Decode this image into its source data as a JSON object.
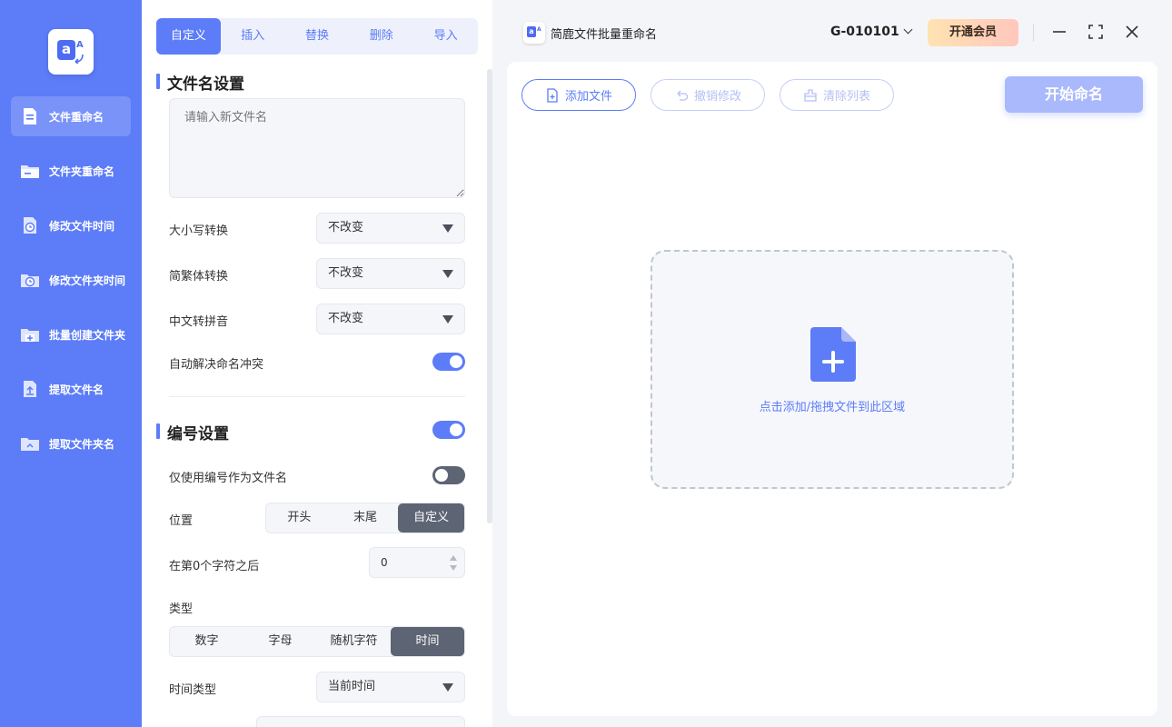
{
  "sidebar": {
    "logo_letter": "a",
    "logo_mini": "A",
    "items": [
      {
        "label": "文件重命名",
        "icon": "document-icon",
        "active": true
      },
      {
        "label": "文件夹重命名",
        "icon": "folder-icon",
        "active": false
      },
      {
        "label": "修改文件时间",
        "icon": "file-clock-icon",
        "active": false
      },
      {
        "label": "修改文件夹时间",
        "icon": "folder-clock-icon",
        "active": false
      },
      {
        "label": "批量创建文件夹",
        "icon": "folder-add-icon",
        "active": false
      },
      {
        "label": "提取文件名",
        "icon": "file-upload-icon",
        "active": false
      },
      {
        "label": "提取文件夹名",
        "icon": "folder-upload-icon",
        "active": false
      }
    ]
  },
  "panel": {
    "tabs": [
      "自定义",
      "插入",
      "替换",
      "删除",
      "导入"
    ],
    "active_tab": 0,
    "filename_section": {
      "title": "文件名设置",
      "textarea_placeholder": "请输入新文件名",
      "case_label": "大小写转换",
      "case_value": "不改变",
      "trad_label": "简繁体转换",
      "trad_value": "不改变",
      "pinyin_label": "中文转拼音",
      "pinyin_value": "不改变",
      "conflict_label": "自动解决命名冲突",
      "conflict_on": true
    },
    "number_section": {
      "title": "编号设置",
      "enabled": true,
      "only_number_label": "仅使用编号作为文件名",
      "only_number_on": false,
      "position_label": "位置",
      "position_options": [
        "开头",
        "末尾",
        "自定义"
      ],
      "position_selected": 2,
      "after_char_label": "在第0个字符之后",
      "after_char_value": "0",
      "type_label": "类型",
      "type_options": [
        "数字",
        "字母",
        "随机字符",
        "时间"
      ],
      "type_selected": 3,
      "time_type_label": "时间类型",
      "time_type_value": "当前时间"
    }
  },
  "titlebar": {
    "app_title": "简鹿文件批量重命名",
    "account": "G-010101",
    "vip_label": "开通会员"
  },
  "main": {
    "add_file": "添加文件",
    "undo": "撤销修改",
    "clear": "清除列表",
    "start": "开始命名",
    "dropzone_text": "点击添加/拖拽文件到此区域"
  },
  "colors": {
    "brand": "#5c7cf8",
    "sidebar": "#5c7cf8",
    "dark_segment": "#5d6473"
  }
}
